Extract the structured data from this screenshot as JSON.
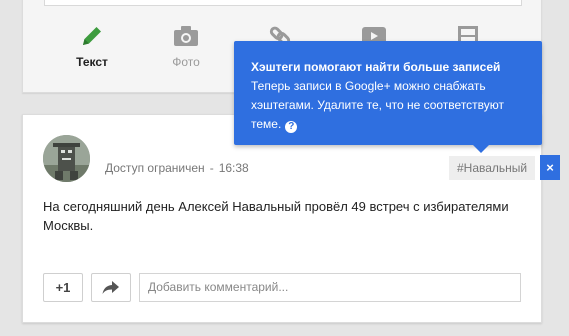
{
  "share_box": {
    "tabs": [
      {
        "label": "Текст",
        "icon": "pencil-icon"
      },
      {
        "label": "Фото",
        "icon": "camera-icon"
      },
      {
        "label": "",
        "icon": "link-icon"
      },
      {
        "label": "",
        "icon": "video-icon"
      },
      {
        "label": "",
        "icon": "event-icon"
      }
    ]
  },
  "tooltip": {
    "title": "Хэштеги помогают найти больше записей",
    "body": "Теперь записи в Google+ можно снабжать хэштегами. Удалите те, что не соответствуют теме.",
    "help": "?",
    "close": "×"
  },
  "post": {
    "visibility": "Доступ ограничен",
    "separator": "-",
    "time": "16:38",
    "hashtag": "#Навальный",
    "text": "На сегодняшний день Алексей Навальный провёл 49 встреч с избирателями Москвы.",
    "plusone": "+1",
    "comment_placeholder": "Добавить комментарий..."
  },
  "colors": {
    "accent_blue": "#2f6fe0",
    "active_green": "#3d9c3e"
  }
}
